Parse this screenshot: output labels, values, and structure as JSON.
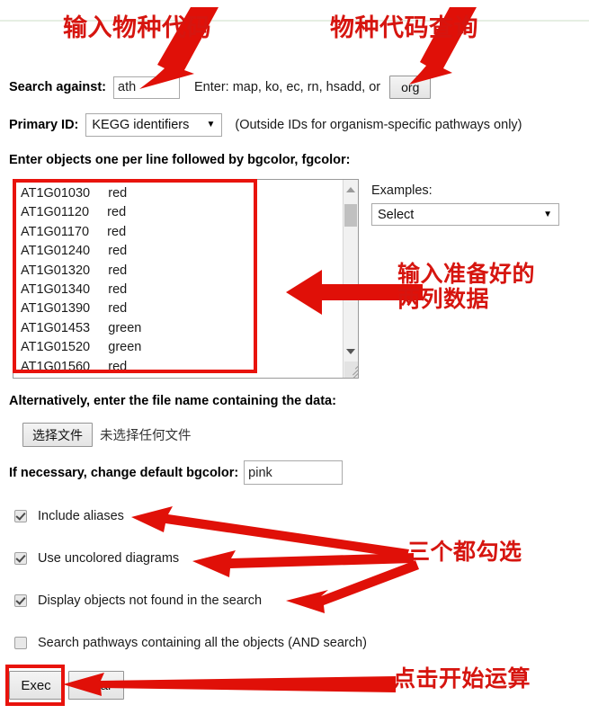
{
  "form": {
    "search_against": {
      "label": "Search against:",
      "value": "ath",
      "hint": "Enter: map, ko, ec, rn, hsadd, or",
      "org_button": "org"
    },
    "primary_id": {
      "label": "Primary ID:",
      "selected": "KEGG identifiers",
      "note": "(Outside IDs for organism-specific pathways only)"
    },
    "objects": {
      "label": "Enter objects one per line followed by bgcolor, fgcolor:",
      "value": "AT1G01030     red\nAT1G01120     red\nAT1G01170     red\nAT1G01240     red\nAT1G01320     red\nAT1G01340     red\nAT1G01390     red\nAT1G01453     green\nAT1G01520     green\nAT1G01560     red",
      "entries": [
        {
          "id": "AT1G01030",
          "color": "red"
        },
        {
          "id": "AT1G01120",
          "color": "red"
        },
        {
          "id": "AT1G01170",
          "color": "red"
        },
        {
          "id": "AT1G01240",
          "color": "red"
        },
        {
          "id": "AT1G01320",
          "color": "red"
        },
        {
          "id": "AT1G01340",
          "color": "red"
        },
        {
          "id": "AT1G01390",
          "color": "red"
        },
        {
          "id": "AT1G01453",
          "color": "green"
        },
        {
          "id": "AT1G01520",
          "color": "green"
        },
        {
          "id": "AT1G01560",
          "color": "red"
        }
      ]
    },
    "examples": {
      "label": "Examples:",
      "selected": "Select"
    },
    "file": {
      "label": "Alternatively, enter the file name containing the data:",
      "button": "选择文件",
      "status": "未选择任何文件"
    },
    "bgcolor": {
      "label": "If necessary, change default bgcolor:",
      "value": "pink"
    },
    "checkboxes": [
      {
        "label": "Include aliases",
        "checked": true
      },
      {
        "label": "Use uncolored diagrams",
        "checked": true
      },
      {
        "label": "Display objects not found in the search",
        "checked": true
      },
      {
        "label": "Search pathways containing all the objects (AND search)",
        "checked": false
      }
    ],
    "buttons": {
      "exec": "Exec",
      "clear": "Clear"
    }
  },
  "annotations": {
    "color": "#d6150f",
    "items": [
      {
        "text": "输入物种代码"
      },
      {
        "text": "物种代码查询"
      },
      {
        "text": "输入准备好的\n两列数据"
      },
      {
        "text": "三个都勾选"
      },
      {
        "text": "点击开始运算"
      }
    ]
  }
}
